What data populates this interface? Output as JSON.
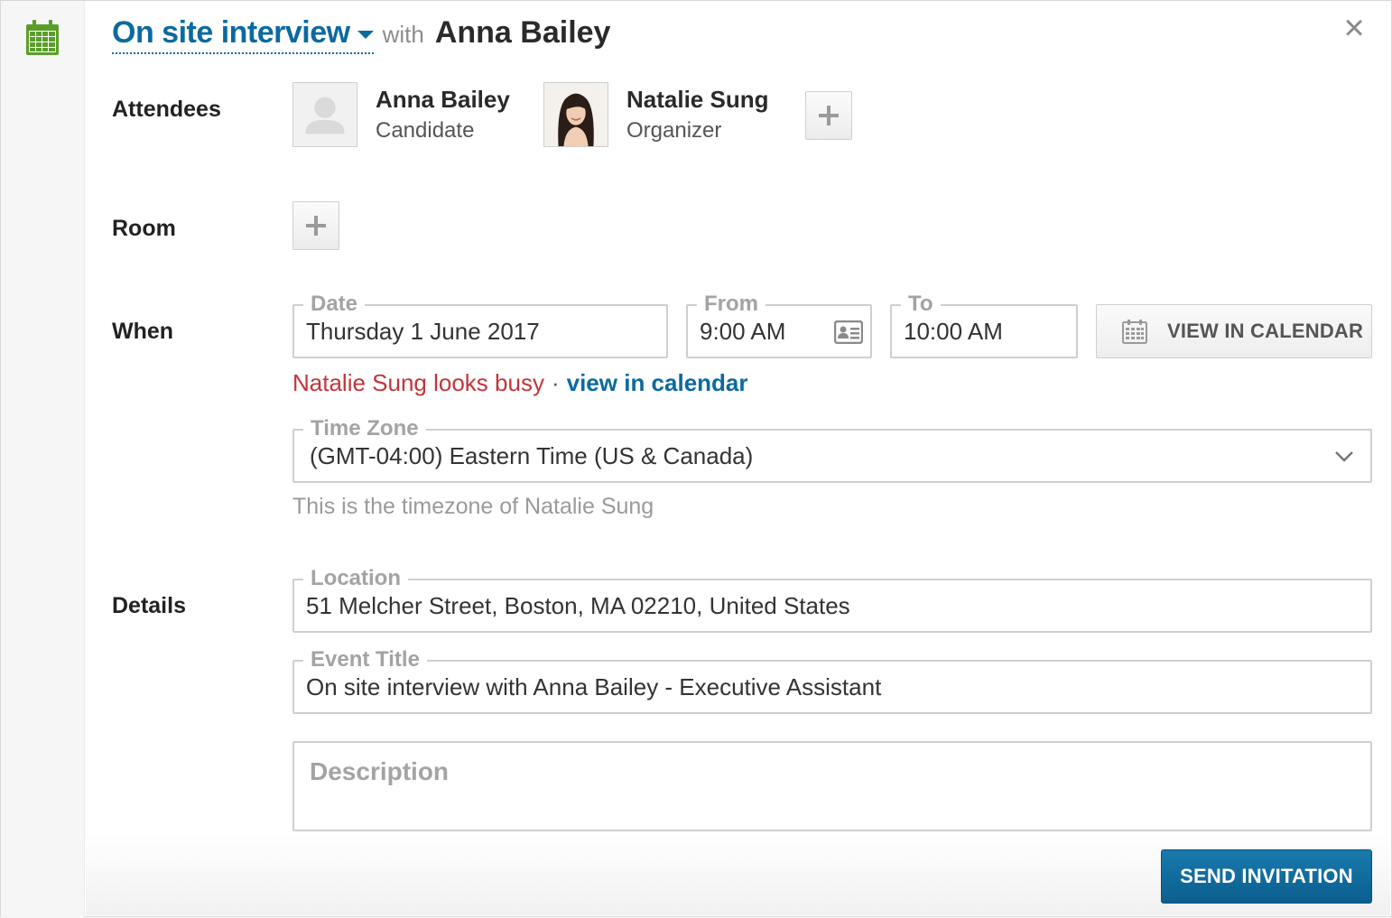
{
  "header": {
    "event_type": "On site interview",
    "with_word": "with",
    "candidate_name": "Anna Bailey"
  },
  "labels": {
    "attendees": "Attendees",
    "room": "Room",
    "when": "When",
    "details": "Details"
  },
  "attendees": [
    {
      "name": "Anna Bailey",
      "role": "Candidate",
      "avatar": "placeholder-person-icon"
    },
    {
      "name": "Natalie Sung",
      "role": "Organizer",
      "avatar": "profile-photo"
    }
  ],
  "when": {
    "date_legend": "Date",
    "date_value": "Thursday 1 June 2017",
    "from_legend": "From",
    "from_value": "9:00 AM",
    "to_legend": "To",
    "to_value": "10:00 AM",
    "view_calendar_button": "VIEW IN CALENDAR",
    "busy_text": "Natalie Sung looks busy",
    "separator": "·",
    "busy_link": "view in calendar",
    "timezone_legend": "Time Zone",
    "timezone_value": "(GMT-04:00) Eastern Time (US & Canada)",
    "timezone_note": "This is the timezone of Natalie Sung"
  },
  "details": {
    "location_legend": "Location",
    "location_value": "51 Melcher Street, Boston, MA 02210, United States",
    "title_legend": "Event Title",
    "title_value": "On site interview with Anna Bailey - Executive Assistant",
    "description_placeholder": "Description"
  },
  "actions": {
    "send_button": "SEND INVITATION",
    "close_symbol": "×"
  },
  "colors": {
    "link_blue": "#0b6a9f",
    "busy_red": "#c3343a",
    "calendar_green": "#5a9e2a"
  }
}
